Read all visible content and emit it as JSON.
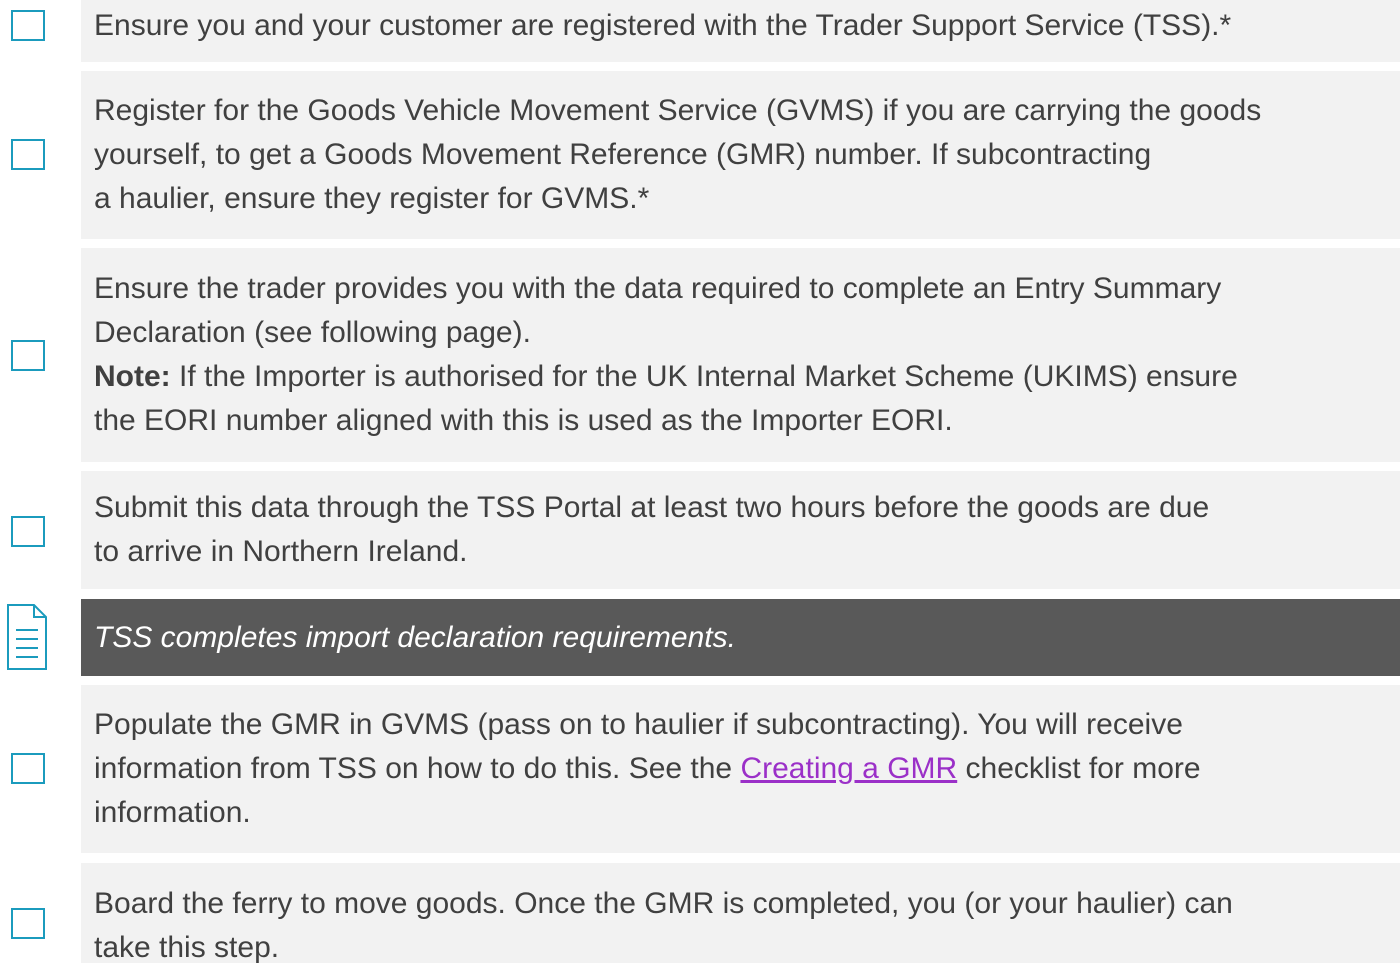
{
  "checklist": {
    "item1": {
      "lines": [
        "Ensure you and your customer are registered with the Trader Support Service (TSS).*"
      ]
    },
    "item2": {
      "lines": [
        "Register for the Goods Vehicle Movement Service (GVMS) if you are carrying the goods",
        "yourself, to get a Goods Movement Reference (GMR) number. If subcontracting",
        "a haulier, ensure they register for GVMS.*"
      ]
    },
    "item3": {
      "lines": [
        "Ensure the trader provides you with the data required to complete an Entry Summary",
        "Declaration (see following page)."
      ],
      "note_label": "Note:",
      "note_line1": " If the Importer is authorised for the UK Internal Market Scheme (UKIMS) ensure",
      "note_line2": "the EORI number aligned with this is used as the Importer EORI."
    },
    "item4": {
      "lines": [
        "Submit this data through the TSS Portal at least two hours before the goods are due",
        "to arrive in Northern Ireland."
      ]
    },
    "info": {
      "icon": "document-icon",
      "text": "TSS completes import declaration requirements."
    },
    "item5": {
      "line1": "Populate the GMR in GVMS (pass on to haulier if subcontracting). You will receive",
      "line2_before": "information from TSS on how to do this. See the ",
      "link_text": "Creating a GMR",
      "line2_after": " checklist for more",
      "line3": "information."
    },
    "item6": {
      "lines": [
        "Board the ferry to move goods. Once the GMR is completed, you (or your haulier) can",
        "take this step."
      ]
    }
  },
  "colors": {
    "panel": "#f2f2f2",
    "info_panel": "#595959",
    "checkbox_border": "#1b9bbd",
    "link": "#9b30c8",
    "text": "#404040"
  }
}
